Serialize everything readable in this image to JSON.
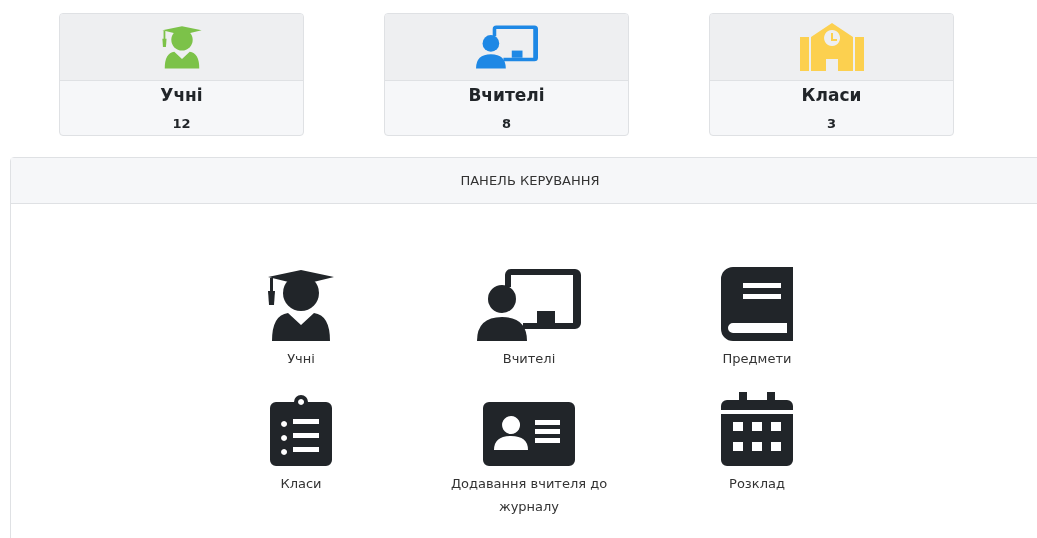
{
  "stats": [
    {
      "label": "Учні",
      "count": "12"
    },
    {
      "label": "Вчителі",
      "count": "8"
    },
    {
      "label": "Класи",
      "count": "3"
    }
  ],
  "panel": {
    "title": "ПАНЕЛЬ КЕРУВАННЯ",
    "items": [
      {
        "label": "Учні"
      },
      {
        "label": "Вчителі"
      },
      {
        "label": "Предмети"
      },
      {
        "label": "Класи"
      },
      {
        "label": "Додавання вчителя до журналу"
      },
      {
        "label": "Розклад"
      }
    ]
  }
}
